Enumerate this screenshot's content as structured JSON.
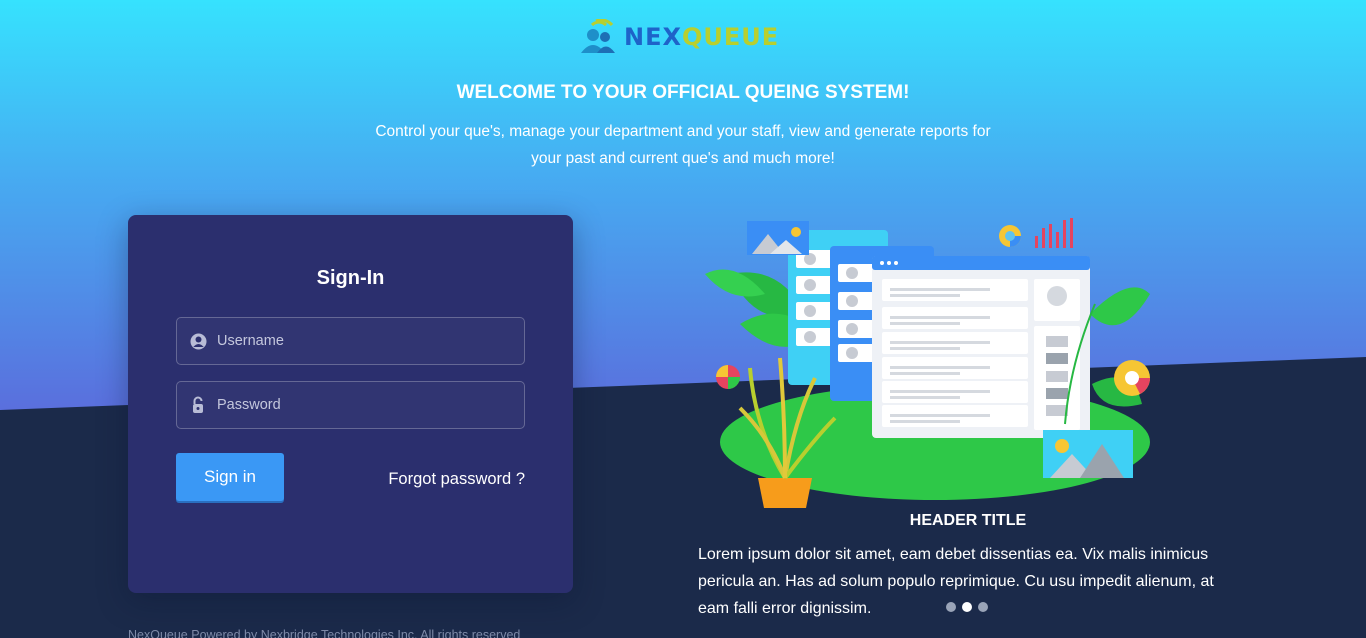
{
  "brand": {
    "part1": "NEX",
    "part2": "QUEUE"
  },
  "hero": {
    "title": "WELCOME TO YOUR OFFICIAL QUEING SYSTEM!",
    "subtitle": "Control your que's, manage your department and your staff, view and generate reports for your past and current que's and much more!"
  },
  "login": {
    "title": "Sign-In",
    "username_placeholder": "Username",
    "password_placeholder": "Password",
    "username_value": "",
    "password_value": "",
    "signin_label": "Sign in",
    "forgot_label": "Forgot password ?"
  },
  "footer": {
    "text": "NexQueue Powered by Nexbridge Technologies Inc. All rights reserved"
  },
  "slide": {
    "header": "HEADER TITLE",
    "body": "Lorem ipsum dolor sit amet, eam debet dissentias ea. Vix malis inimicus pericula an. Has ad solum populo reprimique. Cu usu impedit alienum, at eam falli error dignissim.",
    "total_slides": 3,
    "active_index": 1
  },
  "colors": {
    "gradient_top": "#34e1fd",
    "gradient_mid": "#4aa6f0",
    "gradient_bottom": "#5a73e0",
    "dark_bg": "#1b2a4a",
    "card_bg": "#2b2f6e",
    "button": "#3a98f5"
  },
  "icons": {
    "username": "user-circle-icon",
    "password": "lock-icon"
  }
}
